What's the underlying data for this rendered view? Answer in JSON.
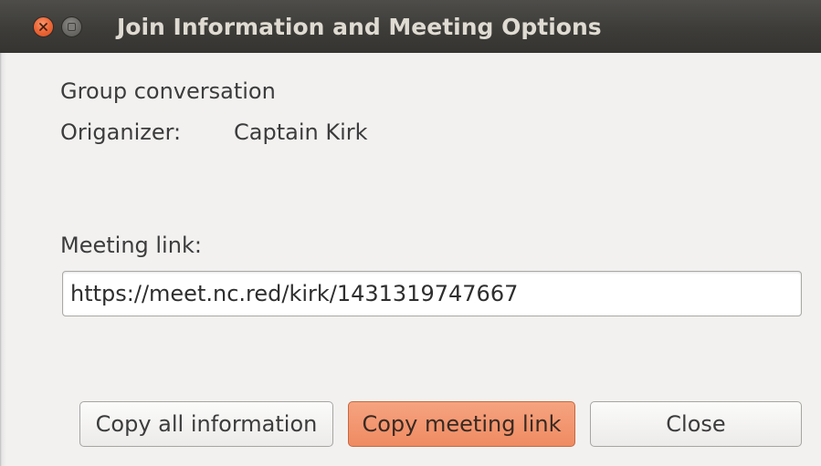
{
  "window": {
    "title": "Join Information and Meeting Options"
  },
  "dialog": {
    "conversation_type": "Group conversation",
    "organizer_label": "Origanizer:",
    "organizer_name": "Captain Kirk",
    "meeting_link_label": "Meeting link:",
    "meeting_link_value": "https://meet.nc.red/kirk/1431319747667"
  },
  "buttons": {
    "copy_all": "Copy all information",
    "copy_link": "Copy meeting link",
    "close": "Close"
  },
  "colors": {
    "titlebar": "#3d3c39",
    "close_button": "#ef6a3a",
    "focused_button": "#ef8b62",
    "background": "#f2f1f0"
  },
  "icons": {
    "window_close": "close-icon",
    "window_minimize": "minimize-icon"
  }
}
